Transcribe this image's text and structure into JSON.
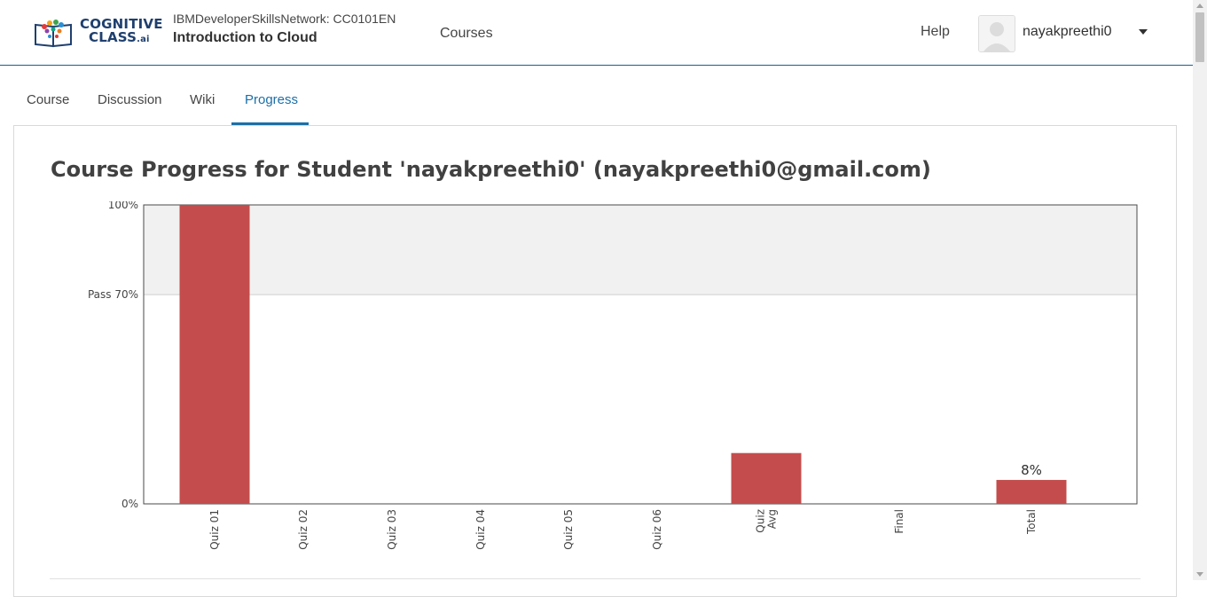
{
  "header": {
    "logo": {
      "line1": "COGNITIVE",
      "line2": "CLASS",
      "suffix": ".ai"
    },
    "course_org": "IBMDeveloperSkillsNetwork: CC0101EN",
    "course_name": "Introduction to Cloud",
    "nav_courses": "Courses",
    "help": "Help",
    "username": "nayakpreethi0"
  },
  "tabs": [
    {
      "label": "Course"
    },
    {
      "label": "Discussion"
    },
    {
      "label": "Wiki"
    },
    {
      "label": "Progress"
    }
  ],
  "active_tab": "Progress",
  "page": {
    "title": "Course Progress for Student 'nayakpreethi0' (nayakpreethi0@gmail.com)"
  },
  "colors": {
    "bar": "#c44c4c",
    "pass_band": "#f1f1f1",
    "accent": "#1b6fa8"
  },
  "chart_data": {
    "type": "bar",
    "categories": [
      "Quiz 01",
      "Quiz 02",
      "Quiz 03",
      "Quiz 04",
      "Quiz 05",
      "Quiz 06",
      "Quiz Avg",
      "Final",
      "Total"
    ],
    "values": [
      100,
      0,
      0,
      0,
      0,
      0,
      17,
      0,
      8
    ],
    "value_unit": "%",
    "y_ticks": [
      {
        "value": 100,
        "label": "100%"
      },
      {
        "value": 70,
        "label": "Pass 70%"
      },
      {
        "value": 0,
        "label": "0%"
      }
    ],
    "pass_threshold": 70,
    "annotations": [
      {
        "category": "Total",
        "label": "8%"
      }
    ],
    "ylim": [
      0,
      100
    ],
    "grid": false
  }
}
